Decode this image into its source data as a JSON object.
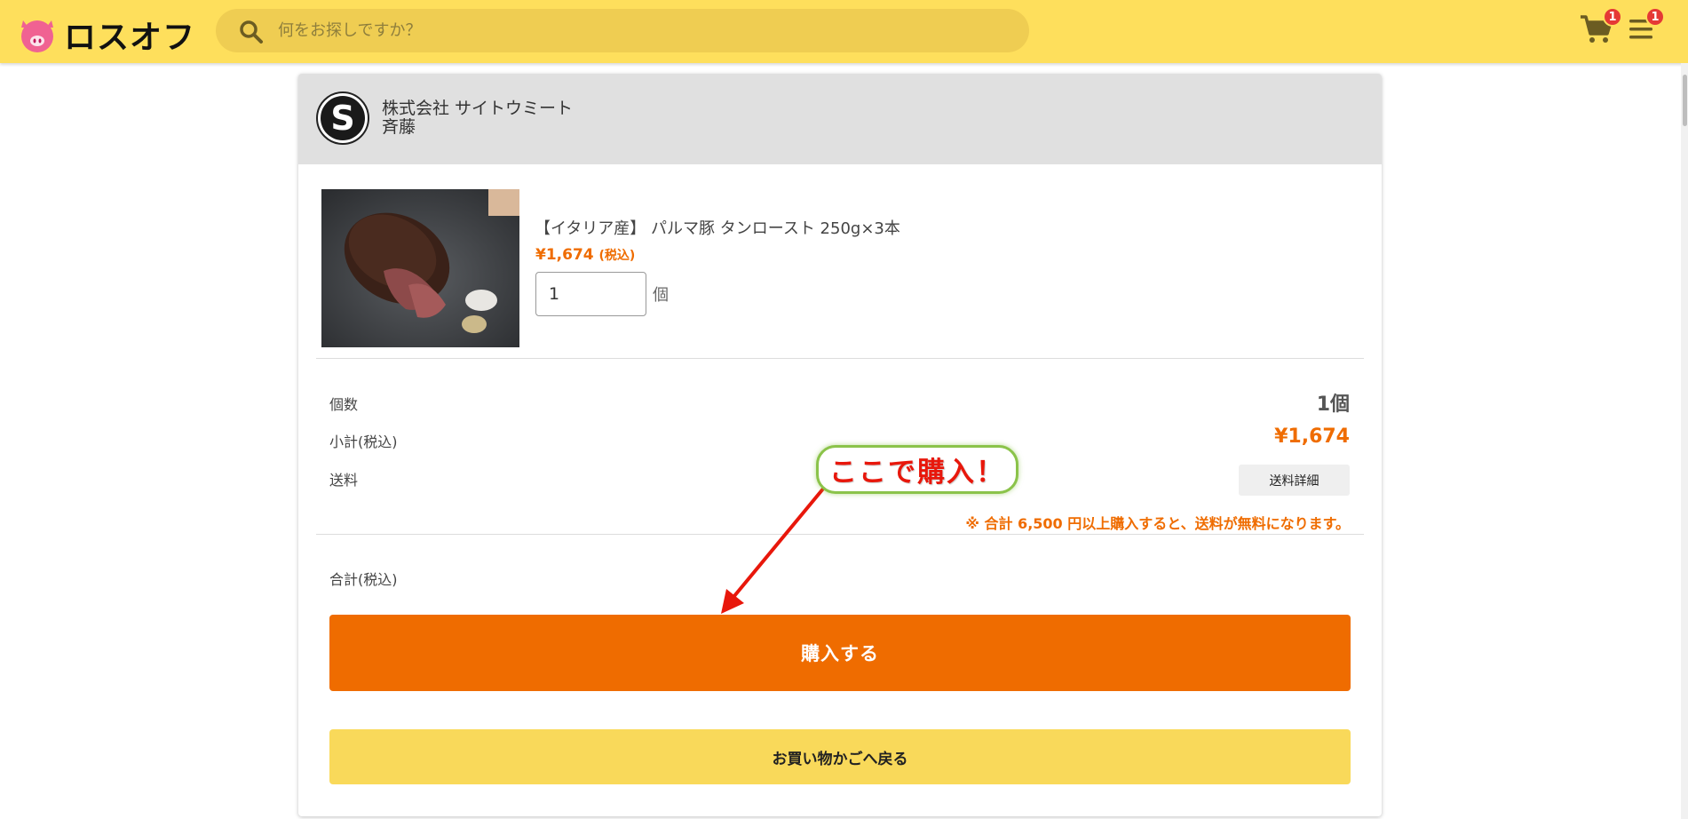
{
  "header": {
    "logo_text": "ロスオフ",
    "search_placeholder": "何をお探しですか？",
    "cart_badge": "1",
    "menu_badge": "1"
  },
  "shop": {
    "name": "株式会社 サイトウミート",
    "person": "斉藤"
  },
  "product": {
    "title": "【イタリア産】 パルマ豚 タンロースト 250g×3本",
    "price": "¥1,674",
    "price_note": "(税込)",
    "quantity": "1",
    "quantity_unit": "個"
  },
  "summary": {
    "count_label": "個数",
    "count_value": "1個",
    "subtotal_label": "小計(税込)",
    "subtotal_value": "¥1,674",
    "shipping_label": "送料",
    "shipping_detail_button": "送料詳細",
    "shipping_note": "※ 合計 6,500 円以上購入すると、送料が無料になります。",
    "total_label": "合計(税込)"
  },
  "actions": {
    "buy_label": "購入する",
    "back_label": "お買い物かごへ戻る"
  },
  "annotation": {
    "text": "ここで購入！"
  },
  "colors": {
    "header_bg": "#fedf5c",
    "accent_orange": "#ef6c00",
    "back_button_bg": "#f9d95a",
    "annotation_red": "#e8170b",
    "annotation_border": "#8bc34a"
  },
  "icons": [
    "pig-logo-icon",
    "search-icon",
    "cart-icon",
    "menu-icon",
    "shop-logo-icon"
  ]
}
